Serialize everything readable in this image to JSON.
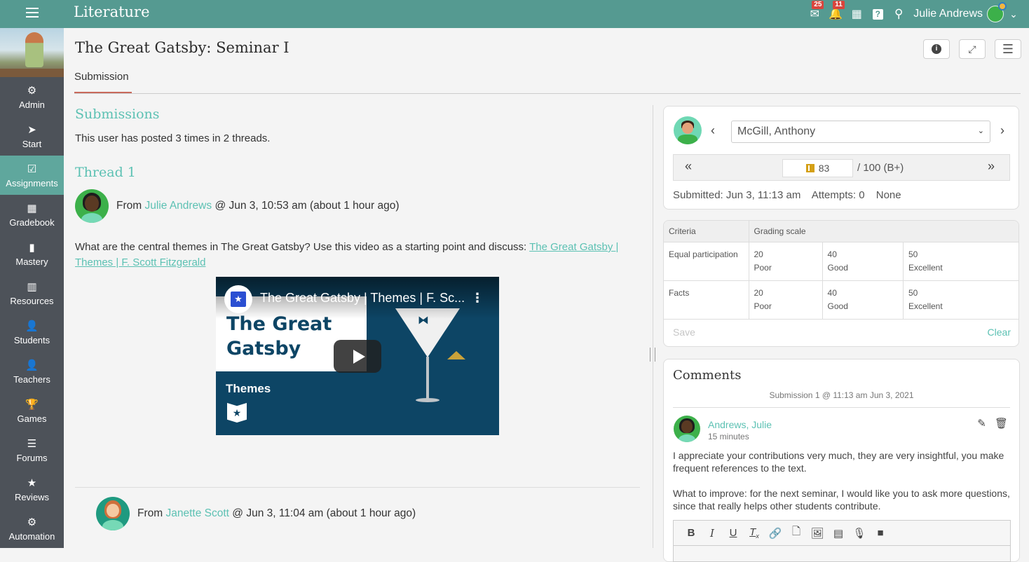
{
  "topbar": {
    "app_title": "Literature",
    "messages_badge": "25",
    "notifications_badge": "11",
    "user_name": "Julie Andrews"
  },
  "sidebar": {
    "items": [
      {
        "label": "Admin",
        "icon": "gear-icon",
        "glyph": "⚙"
      },
      {
        "label": "Start",
        "icon": "location-arrow-icon",
        "glyph": "➤"
      },
      {
        "label": "Assignments",
        "icon": "assignment-check-icon",
        "glyph": "☑",
        "active": true
      },
      {
        "label": "Gradebook",
        "icon": "gradebook-icon",
        "glyph": "▦"
      },
      {
        "label": "Mastery",
        "icon": "bar-chart-icon",
        "glyph": "▮"
      },
      {
        "label": "Resources",
        "icon": "books-icon",
        "glyph": "▥"
      },
      {
        "label": "Students",
        "icon": "student-icon",
        "glyph": "👤"
      },
      {
        "label": "Teachers",
        "icon": "teacher-icon",
        "glyph": "👤"
      },
      {
        "label": "Games",
        "icon": "trophy-icon",
        "glyph": "🏆"
      },
      {
        "label": "Forums",
        "icon": "list-icon",
        "glyph": "☰"
      },
      {
        "label": "Reviews",
        "icon": "star-icon",
        "glyph": "★"
      },
      {
        "label": "Automation",
        "icon": "cogs-icon",
        "glyph": "⚙"
      }
    ]
  },
  "page": {
    "title": "The Great Gatsby: Seminar I",
    "tab": "Submission"
  },
  "submissions": {
    "heading": "Submissions",
    "summary": "This user has posted 3 times in 2 threads.",
    "thread_heading": "Thread 1",
    "post1": {
      "from_prefix": "From",
      "author": "Julie Andrews",
      "when": "@ Jun 3, 10:53 am (about 1 hour ago)",
      "body": "What are the central themes in The Great Gatsby? Use this video as a starting point and discuss: ",
      "link": "The Great Gatsby | Themes | F. Scott Fitzgerald"
    },
    "video": {
      "title": "The Great Gatsby | Themes | F. Sc...",
      "card_line1": "The Great",
      "card_line2": "Gatsby",
      "section": "Themes"
    },
    "post2": {
      "from_prefix": "From",
      "author": "Janette Scott",
      "when": "@ Jun 3, 11:04 am (about 1 hour ago)"
    }
  },
  "grading": {
    "student": "McGill, Anthony",
    "score": "83",
    "total": "/ 100 (B+)",
    "submitted": "Submitted: Jun 3, 11:13 am",
    "attempts": "Attempts: 0",
    "status": "None"
  },
  "rubric": {
    "col_criteria": "Criteria",
    "col_scale": "Grading scale",
    "rows": [
      {
        "criterion": "Equal participation",
        "levels": [
          {
            "points": "20",
            "label": "Poor"
          },
          {
            "points": "40",
            "label": "Good"
          },
          {
            "points": "50",
            "label": "Excellent"
          }
        ]
      },
      {
        "criterion": "Facts",
        "levels": [
          {
            "points": "20",
            "label": "Poor"
          },
          {
            "points": "40",
            "label": "Good"
          },
          {
            "points": "50",
            "label": "Excellent"
          }
        ]
      }
    ],
    "save_label": "Save",
    "clear_label": "Clear"
  },
  "comments": {
    "heading": "Comments",
    "submission_label": "Submission 1 @ 11:13 am Jun 3, 2021",
    "author": "Andrews, Julie",
    "time": "15 minutes",
    "para1": "I appreciate your contributions very much, they are very insightful, you make frequent references to the text.",
    "para2": "What to improve: for the next seminar, I would like you to ask more questions, since that really helps other students contribute."
  },
  "colors": {
    "topbar": "#559a91",
    "accent": "#5cc1b3",
    "sidebar": "#4d5259",
    "sidebar_active": "#5fa79d",
    "tab_underline": "#c96a5c",
    "badge": "#d9453d"
  }
}
